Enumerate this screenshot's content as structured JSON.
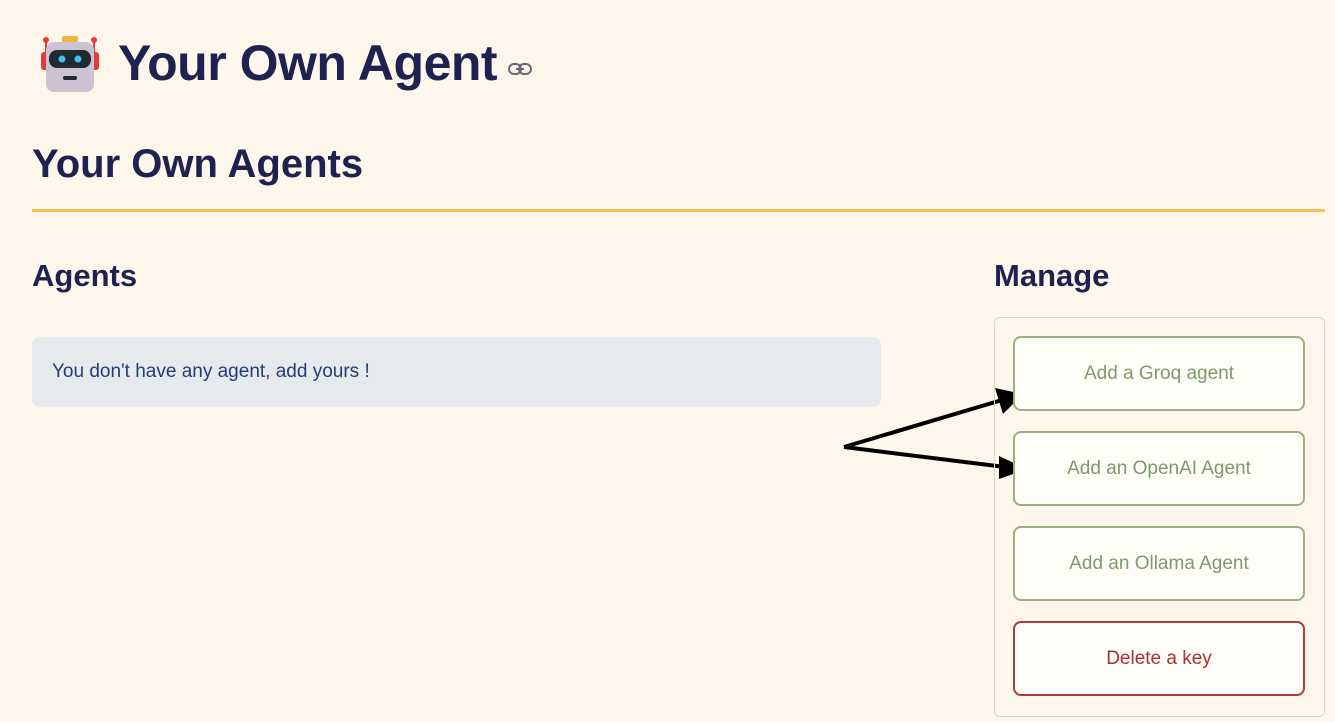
{
  "header": {
    "title": "Your Own Agent",
    "logo_icon": "robot-icon",
    "anchor_icon": "link-icon"
  },
  "section": {
    "title": "Your Own Agents",
    "divider_color": "#f6c35b"
  },
  "agents": {
    "heading": "Agents",
    "empty_message": "You don't have any agent, add yours !"
  },
  "manage": {
    "heading": "Manage",
    "buttons": {
      "groq": "Add a Groq agent",
      "openai": "Add an OpenAI Agent",
      "ollama": "Add an Ollama Agent",
      "delete": "Delete a key"
    }
  },
  "colors": {
    "background": "#fdf6ea",
    "text_primary": "#1f2150",
    "info_text": "#1e3f76",
    "button_green": "#9cb07e",
    "button_red": "#b03a3a"
  }
}
